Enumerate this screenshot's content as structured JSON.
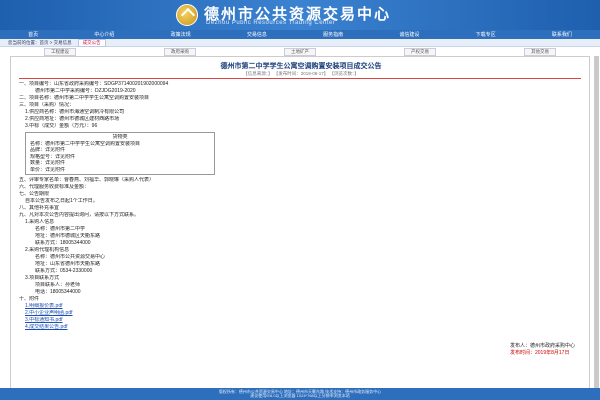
{
  "banner": {
    "title_cn": "德州市公共资源交易中心",
    "title_en": "Dezhou Public Resources Trading Center"
  },
  "nav": [
    "首页",
    "中心介绍",
    "政策法规",
    "交易信息",
    "服务指南",
    "诚信建设",
    "下载专区",
    "联系我们"
  ],
  "subnav": {
    "crumb": "您当前的位置：首页 > 交易信息",
    "tab": "成交公告"
  },
  "tabrow": [
    "工程建设",
    "政府采购",
    "土地矿产",
    "产权交易",
    "其他交易"
  ],
  "doc": {
    "title": "德州市第二中学学生公寓空调购置安装项目成交公告",
    "meta": "【信息来源：】 【发布时间：2019-08-17】 【浏览次数：】",
    "lines": [
      "一、项目编号：山东省政府采购编号：SDGP371400201902000094",
      "       德州市第二中学采购编号：DZJDG2019-2020",
      "二、项目名称：德州市第二中学学生公寓空调购置安装项目",
      "三、项目（采购）情况：",
      "1.供应商名称：德州市海通空调制冷有限公司",
      "2.供应商地址：德州市德城区建材西路市场",
      "3.中标（成交）金额（万元）：96"
    ],
    "box": {
      "head": "货物类",
      "rows": [
        "名称：德州市第二中学学生公寓空调购置安装项目",
        "品牌：详见附件",
        "规格型号：详见附件",
        "数量：详见附件",
        "单价：详见附件"
      ]
    },
    "lines2": [
      "五、评审专家名单：曹春燕、刘福华、郭晓琳（采购人代表）",
      "六、代理服务收费标准及金额：",
      "七、公告期限",
      "  自本公告发布之日起1个工作日。",
      "八、其他补充事宜",
      "九、凡对本次公告内容提出询问，请按以下方式联系。",
      "1.采购人信息",
      "  名称：德州市第二中学",
      "  地址：德州市德城区天衢东路",
      "  联系方式：18005344000",
      "2.采购代理机构信息",
      "  名称：德州市公共资源交易中心",
      "  地址：山东省德州市天衢东路",
      "  联系方式：0534-2330000",
      "3.项目联系方式",
      "  项目联系人：孙老师",
      "  电话：18005344000",
      "十、附件"
    ],
    "attachments": [
      "1.明细报价表.pdf",
      "2.中小企业声明函.pdf",
      "3.中标通知书.pdf",
      "4.成交结果公告.pdf"
    ],
    "sign": {
      "org": "发布人：德州市政府采购中心",
      "date": "发布时间：2019年8月17日"
    }
  },
  "footer": {
    "line1": "版权所有：德州市公共资源交易中心  地址：德州市天衢东路  技术支持：德州市政务服务中心",
    "line2": "建议使用IE8.0以上浏览器  1024*768以上分辨率浏览本站"
  },
  "colors": {
    "brand": "#2d6fbd",
    "title": "#1a3e7a",
    "rule": "#dd4444"
  }
}
